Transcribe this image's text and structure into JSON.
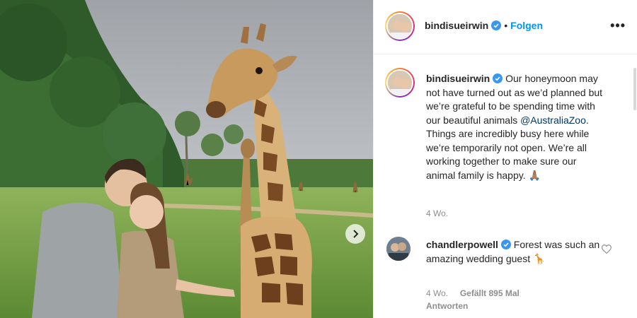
{
  "post": {
    "username": "bindisueirwin",
    "follow_label": "Folgen",
    "separator": "•",
    "more_label": "•••",
    "caption": {
      "username": "bindisueirwin",
      "text_before": " Our honeymoon may not have turned out as we’d planned but we’re grateful to be spending time with our beautiful animals ",
      "mention": "@AustraliaZoo",
      "text_after": ". Things are incredibly busy here while we’re temporarily not open. We’re all working together to make sure our animal family is happy. 🙏🏽",
      "time": "4 Wo."
    },
    "comments": [
      {
        "username": "chandlerpowell",
        "text": " Forest was such an amazing wedding guest 🦒",
        "time": "4 Wo.",
        "likes": "Gefällt 895 Mal",
        "reply_label": "Antworten"
      }
    ]
  },
  "colors": {
    "accent": "#0095f6",
    "verified": "#3897f0",
    "text": "#262626",
    "muted": "#8e8e8e"
  },
  "icons": [
    "verified-badge-icon",
    "heart-icon",
    "chevron-right-icon",
    "more-options-icon"
  ]
}
